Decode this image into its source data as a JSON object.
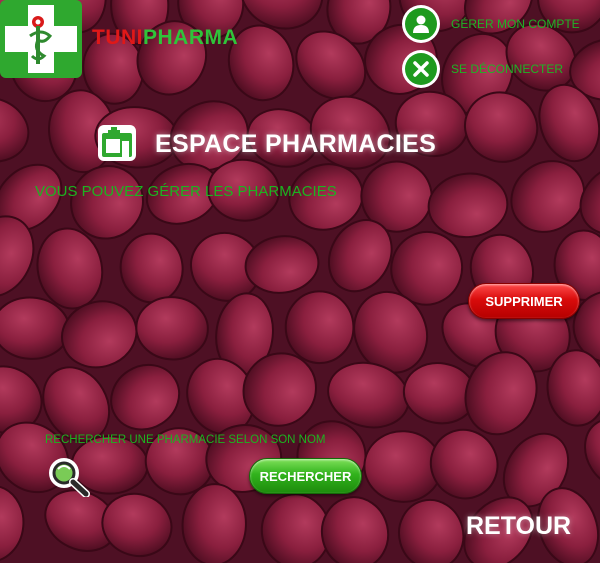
{
  "colors": {
    "accent_green": "#1cb320",
    "brand_red": "#e01818",
    "background": "#5a1428"
  },
  "brand": {
    "part1": "TUNI",
    "part2": "PHARMA"
  },
  "nav": {
    "account": {
      "label": "GÉRER MON COMPTE",
      "icon": "user-icon"
    },
    "logout": {
      "label": "SE DÉCONNECTER",
      "icon": "close-icon"
    }
  },
  "header": {
    "title": "ESPACE PHARMACIES",
    "subtitle": "VOUS POUVEZ GÉRER LES PHARMACIES"
  },
  "actions": {
    "delete_label": "SUPPRIMER"
  },
  "search": {
    "label": "RECHERCHER UNE PHARMACIE SELON SON NOM",
    "button_label": "RECHERCHER",
    "icon": "magnifier-icon"
  },
  "footer": {
    "back_label": "RETOUR"
  }
}
